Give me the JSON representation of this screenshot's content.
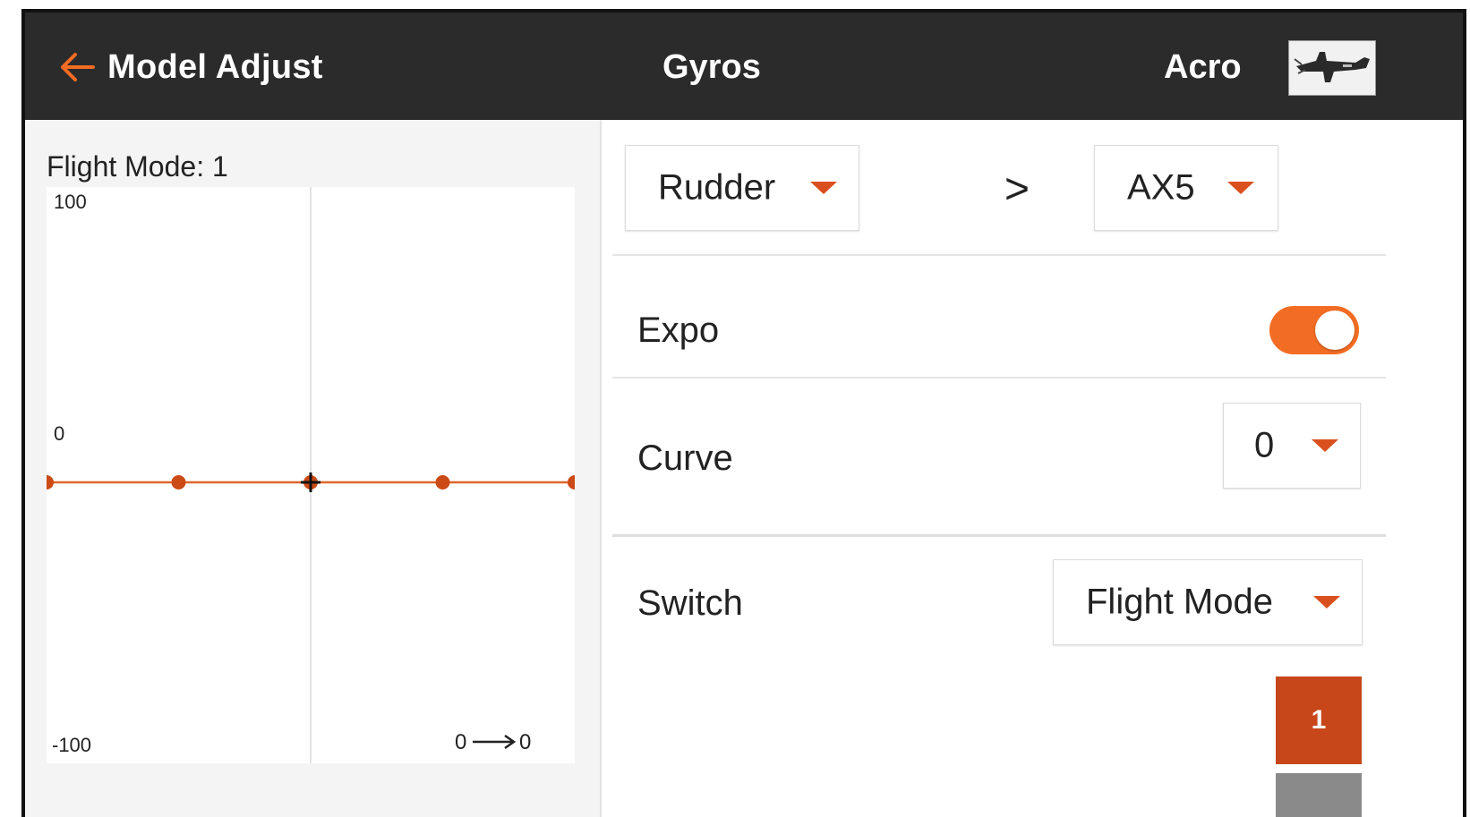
{
  "header": {
    "back_label": "Model Adjust",
    "title": "Gyros",
    "model_name": "Acro"
  },
  "left_panel": {
    "flight_mode_label": "Flight Mode: 1"
  },
  "chart_data": {
    "type": "line",
    "title": "",
    "xlabel": "",
    "ylabel": "",
    "xlim": [
      -100,
      100
    ],
    "ylim": [
      -100,
      100
    ],
    "y_tick_labels": [
      "100",
      "0",
      "-100"
    ],
    "series": [
      {
        "x": [
          -100,
          -50,
          0,
          50,
          100
        ],
        "y": [
          0,
          0,
          0,
          0,
          0
        ]
      }
    ],
    "cursor": {
      "x": 0,
      "y": 0
    },
    "readout": {
      "input": "0",
      "output": "0"
    },
    "grid": "center cross",
    "colors": {
      "line": "#e0662c",
      "point": "#cc4a16",
      "cursor": "#111111"
    }
  },
  "right_panel": {
    "source_dropdown": "Rudder",
    "separator_symbol": ">",
    "target_dropdown": "AX5",
    "expo": {
      "label": "Expo",
      "on": true
    },
    "curve": {
      "label": "Curve",
      "value": "0"
    },
    "switch": {
      "label": "Switch",
      "value": "Flight Mode"
    },
    "flight_mode_buttons": [
      "1"
    ]
  },
  "colors": {
    "accent": "#f36c23",
    "caret": "#d9501e",
    "active_mode": "#c8471a",
    "header_bg": "#2b2b2b"
  }
}
